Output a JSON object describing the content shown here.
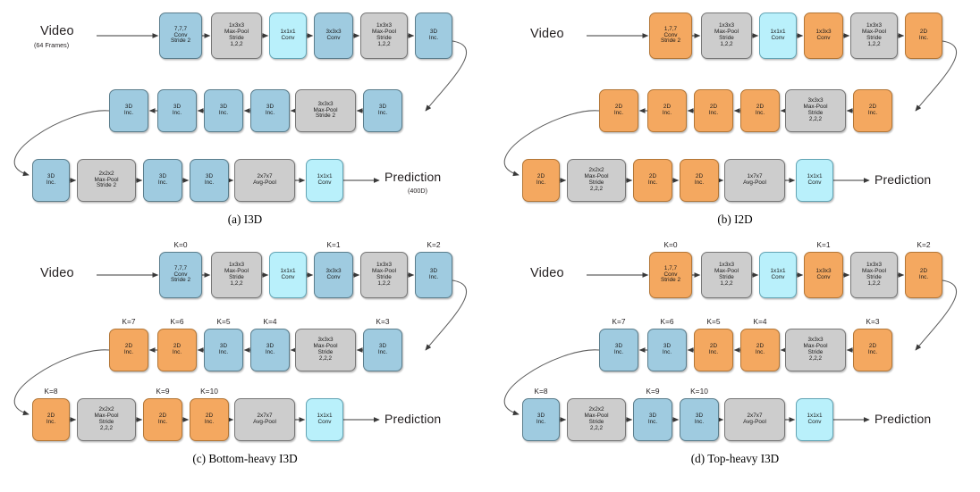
{
  "figure": {
    "title": "Video classification network architectures (I3D variants)",
    "colors": {
      "blue_3d": "#9fcbe0",
      "cyan_conv": "#b9f0fb",
      "orange_2d": "#f4a860",
      "gray_pool": "#cdcdcd",
      "line": "#3a3a3a"
    }
  },
  "panels": [
    {
      "id": "a",
      "caption": "(a)  I3D",
      "input_label": "Video",
      "input_sublabel": "(64 Frames)",
      "output_label": "Prediction",
      "output_sublabel": "(400D)",
      "rows": [
        {
          "blocks": [
            {
              "k": "",
              "color": "blue",
              "lines": [
                "7,7,7",
                "Conv",
                "Stride 2"
              ]
            },
            {
              "k": "",
              "color": "gray",
              "lines": [
                "1x3x3",
                "Max-Pool",
                "Stride",
                "1,2,2"
              ]
            },
            {
              "k": "",
              "color": "cyan",
              "lines": [
                "1x1x1",
                "Conv"
              ]
            },
            {
              "k": "",
              "color": "blue",
              "lines": [
                "3x3x3",
                "Conv"
              ]
            },
            {
              "k": "",
              "color": "gray",
              "lines": [
                "1x3x3",
                "Max-Pool",
                "Stride",
                "1,2,2"
              ]
            },
            {
              "k": "",
              "color": "blue",
              "lines": [
                "3D",
                "Inc."
              ]
            }
          ]
        },
        {
          "blocks": [
            {
              "k": "",
              "color": "blue",
              "lines": [
                "3D",
                "Inc."
              ]
            },
            {
              "k": "",
              "color": "blue",
              "lines": [
                "3D",
                "Inc."
              ]
            },
            {
              "k": "",
              "color": "blue",
              "lines": [
                "3D",
                "Inc."
              ]
            },
            {
              "k": "",
              "color": "blue",
              "lines": [
                "3D",
                "Inc."
              ]
            },
            {
              "k": "",
              "color": "gray",
              "lines": [
                "3x3x3",
                "Max-Pool",
                "Stride 2"
              ]
            },
            {
              "k": "",
              "color": "blue",
              "lines": [
                "3D",
                "Inc."
              ]
            }
          ]
        },
        {
          "blocks": [
            {
              "k": "",
              "color": "blue",
              "lines": [
                "3D",
                "Inc."
              ]
            },
            {
              "k": "",
              "color": "gray",
              "lines": [
                "2x2x2",
                "Max-Pool",
                "Stride 2"
              ]
            },
            {
              "k": "",
              "color": "blue",
              "lines": [
                "3D",
                "Inc."
              ]
            },
            {
              "k": "",
              "color": "blue",
              "lines": [
                "3D",
                "Inc."
              ]
            },
            {
              "k": "",
              "color": "gray",
              "lines": [
                "2x7x7",
                "Avg-Pool"
              ]
            },
            {
              "k": "",
              "color": "cyan",
              "lines": [
                "1x1x1",
                "Conv"
              ]
            }
          ]
        }
      ]
    },
    {
      "id": "b",
      "caption": "(b)  I2D",
      "input_label": "Video",
      "input_sublabel": "",
      "output_label": "Prediction",
      "output_sublabel": "",
      "rows": [
        {
          "blocks": [
            {
              "k": "",
              "color": "orange",
              "lines": [
                "1,7,7",
                "Conv",
                "Stride 2"
              ]
            },
            {
              "k": "",
              "color": "gray",
              "lines": [
                "1x3x3",
                "Max-Pool",
                "Stride",
                "1,2,2"
              ]
            },
            {
              "k": "",
              "color": "cyan",
              "lines": [
                "1x1x1",
                "Conv"
              ]
            },
            {
              "k": "",
              "color": "orange",
              "lines": [
                "1x3x3",
                "Conv"
              ]
            },
            {
              "k": "",
              "color": "gray",
              "lines": [
                "1x3x3",
                "Max-Pool",
                "Stride",
                "1,2,2"
              ]
            },
            {
              "k": "",
              "color": "orange",
              "lines": [
                "2D",
                "Inc."
              ]
            }
          ]
        },
        {
          "blocks": [
            {
              "k": "",
              "color": "orange",
              "lines": [
                "2D",
                "Inc."
              ]
            },
            {
              "k": "",
              "color": "orange",
              "lines": [
                "2D",
                "Inc."
              ]
            },
            {
              "k": "",
              "color": "orange",
              "lines": [
                "2D",
                "Inc."
              ]
            },
            {
              "k": "",
              "color": "orange",
              "lines": [
                "2D",
                "Inc."
              ]
            },
            {
              "k": "",
              "color": "gray",
              "lines": [
                "3x3x3",
                "Max-Pool",
                "Stride",
                "2,2,2"
              ]
            },
            {
              "k": "",
              "color": "orange",
              "lines": [
                "2D",
                "Inc."
              ]
            }
          ]
        },
        {
          "blocks": [
            {
              "k": "",
              "color": "orange",
              "lines": [
                "2D",
                "Inc."
              ]
            },
            {
              "k": "",
              "color": "gray",
              "lines": [
                "2x2x2",
                "Max-Pool",
                "Stride",
                "2,2,2"
              ]
            },
            {
              "k": "",
              "color": "orange",
              "lines": [
                "2D",
                "Inc."
              ]
            },
            {
              "k": "",
              "color": "orange",
              "lines": [
                "2D",
                "Inc."
              ]
            },
            {
              "k": "",
              "color": "gray",
              "lines": [
                "1x7x7",
                "Avg-Pool"
              ]
            },
            {
              "k": "",
              "color": "cyan",
              "lines": [
                "1x1x1",
                "Conv"
              ]
            }
          ]
        }
      ]
    },
    {
      "id": "c",
      "caption": "(c)  Bottom-heavy I3D",
      "input_label": "Video",
      "input_sublabel": "",
      "output_label": "Prediction",
      "output_sublabel": "",
      "rows": [
        {
          "blocks": [
            {
              "k": "K=0",
              "color": "blue",
              "lines": [
                "7,7,7",
                "Conv",
                "Stride 2"
              ]
            },
            {
              "k": "",
              "color": "gray",
              "lines": [
                "1x3x3",
                "Max-Pool",
                "Stride",
                "1,2,2"
              ]
            },
            {
              "k": "",
              "color": "cyan",
              "lines": [
                "1x1x1",
                "Conv"
              ]
            },
            {
              "k": "K=1",
              "color": "blue",
              "lines": [
                "3x3x3",
                "Conv"
              ]
            },
            {
              "k": "",
              "color": "gray",
              "lines": [
                "1x3x3",
                "Max-Pool",
                "Stride",
                "1,2,2"
              ]
            },
            {
              "k": "K=2",
              "color": "blue",
              "lines": [
                "3D",
                "Inc."
              ]
            }
          ]
        },
        {
          "blocks": [
            {
              "k": "K=7",
              "color": "orange",
              "lines": [
                "2D",
                "Inc."
              ]
            },
            {
              "k": "K=6",
              "color": "orange",
              "lines": [
                "2D",
                "Inc."
              ]
            },
            {
              "k": "K=5",
              "color": "blue",
              "lines": [
                "3D",
                "Inc."
              ]
            },
            {
              "k": "K=4",
              "color": "blue",
              "lines": [
                "3D",
                "Inc."
              ]
            },
            {
              "k": "",
              "color": "gray",
              "lines": [
                "3x3x3",
                "Max-Pool",
                "Stride",
                "2,2,2"
              ]
            },
            {
              "k": "K=3",
              "color": "blue",
              "lines": [
                "3D",
                "Inc."
              ]
            }
          ]
        },
        {
          "blocks": [
            {
              "k": "K=8",
              "color": "orange",
              "lines": [
                "2D",
                "Inc."
              ]
            },
            {
              "k": "",
              "color": "gray",
              "lines": [
                "2x2x2",
                "Max-Pool",
                "Stride",
                "2,2,2"
              ]
            },
            {
              "k": "K=9",
              "color": "orange",
              "lines": [
                "2D",
                "Inc."
              ]
            },
            {
              "k": "K=10",
              "color": "orange",
              "lines": [
                "2D",
                "Inc."
              ]
            },
            {
              "k": "",
              "color": "gray",
              "lines": [
                "2x7x7",
                "Avg-Pool"
              ]
            },
            {
              "k": "",
              "color": "cyan",
              "lines": [
                "1x1x1",
                "Conv"
              ]
            }
          ]
        }
      ]
    },
    {
      "id": "d",
      "caption": "(d)  Top-heavy I3D",
      "input_label": "Video",
      "input_sublabel": "",
      "output_label": "Prediction",
      "output_sublabel": "",
      "rows": [
        {
          "blocks": [
            {
              "k": "K=0",
              "color": "orange",
              "lines": [
                "1,7,7",
                "Conv",
                "Stride 2"
              ]
            },
            {
              "k": "",
              "color": "gray",
              "lines": [
                "1x3x3",
                "Max-Pool",
                "Stride",
                "1,2,2"
              ]
            },
            {
              "k": "",
              "color": "cyan",
              "lines": [
                "1x1x1",
                "Conv"
              ]
            },
            {
              "k": "K=1",
              "color": "orange",
              "lines": [
                "1x3x3",
                "Conv"
              ]
            },
            {
              "k": "",
              "color": "gray",
              "lines": [
                "1x3x3",
                "Max-Pool",
                "Stride",
                "1,2,2"
              ]
            },
            {
              "k": "K=2",
              "color": "orange",
              "lines": [
                "2D",
                "Inc."
              ]
            }
          ]
        },
        {
          "blocks": [
            {
              "k": "K=7",
              "color": "blue",
              "lines": [
                "3D",
                "Inc."
              ]
            },
            {
              "k": "K=6",
              "color": "blue",
              "lines": [
                "3D",
                "Inc."
              ]
            },
            {
              "k": "K=5",
              "color": "orange",
              "lines": [
                "2D",
                "Inc."
              ]
            },
            {
              "k": "K=4",
              "color": "orange",
              "lines": [
                "2D",
                "Inc."
              ]
            },
            {
              "k": "",
              "color": "gray",
              "lines": [
                "3x3x3",
                "Max-Pool",
                "Stride",
                "2,2,2"
              ]
            },
            {
              "k": "K=3",
              "color": "orange",
              "lines": [
                "2D",
                "Inc."
              ]
            }
          ]
        },
        {
          "blocks": [
            {
              "k": "K=8",
              "color": "blue",
              "lines": [
                "3D",
                "Inc."
              ]
            },
            {
              "k": "",
              "color": "gray",
              "lines": [
                "2x2x2",
                "Max-Pool",
                "Stride",
                "2,2,2"
              ]
            },
            {
              "k": "K=9",
              "color": "blue",
              "lines": [
                "3D",
                "Inc."
              ]
            },
            {
              "k": "K=10",
              "color": "blue",
              "lines": [
                "3D",
                "Inc."
              ]
            },
            {
              "k": "",
              "color": "gray",
              "lines": [
                "2x7x7",
                "Avg-Pool"
              ]
            },
            {
              "k": "",
              "color": "cyan",
              "lines": [
                "1x1x1",
                "Conv"
              ]
            }
          ]
        }
      ]
    }
  ]
}
